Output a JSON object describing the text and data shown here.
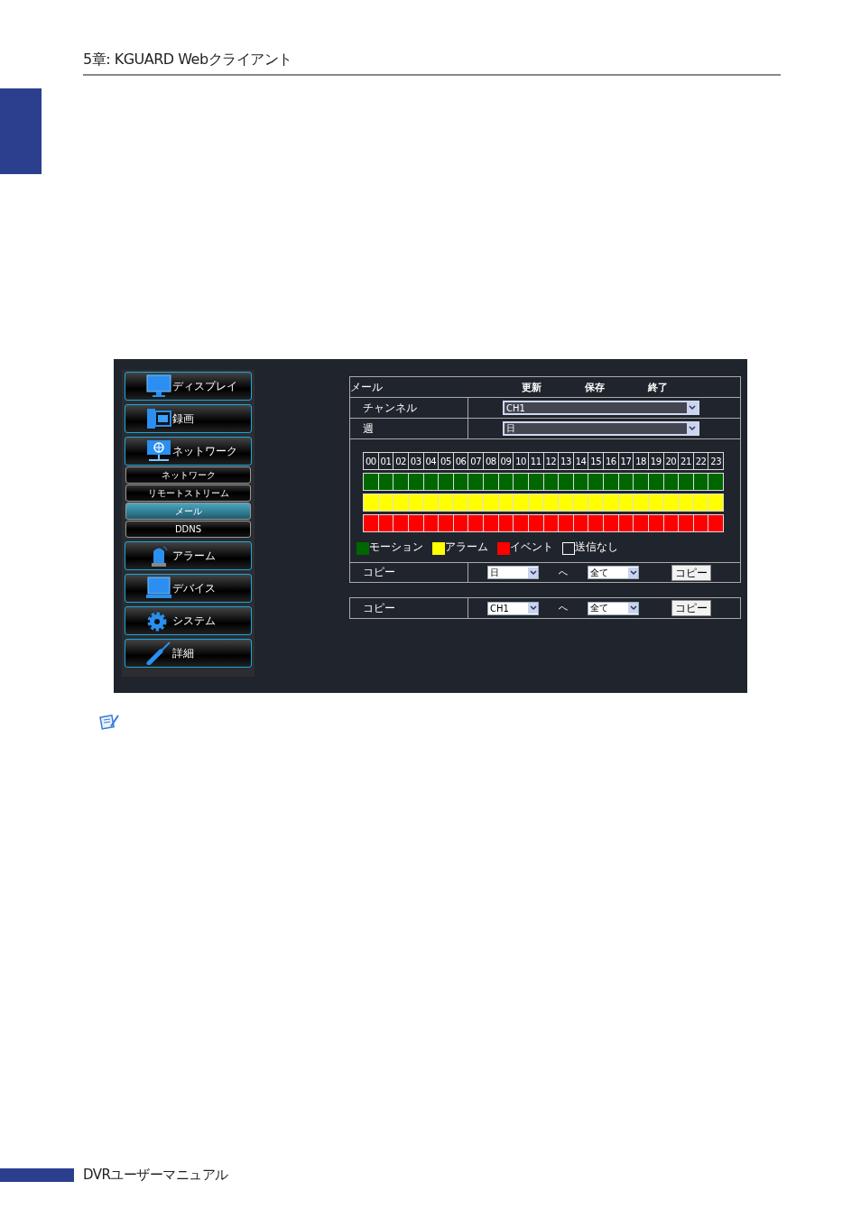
{
  "page_header": {
    "title": "5章: KGUARD Webクライアント"
  },
  "sidebar": {
    "items": [
      {
        "label": "ディスプレイ",
        "kind": "monitor"
      },
      {
        "label": "録画",
        "kind": "film"
      },
      {
        "label": "ネットワーク",
        "kind": "network",
        "children": [
          {
            "label": "ネットワーク",
            "selected": false
          },
          {
            "label": "リモートストリーム",
            "selected": false
          },
          {
            "label": "メール",
            "selected": true
          },
          {
            "label": "DDNS",
            "selected": false
          }
        ]
      },
      {
        "label": "アラーム",
        "kind": "alarm"
      },
      {
        "label": "デバイス",
        "kind": "laptop"
      },
      {
        "label": "システム",
        "kind": "gear"
      },
      {
        "label": "詳細",
        "kind": "tool"
      }
    ]
  },
  "panel": {
    "title": "メール",
    "actions": [
      "更新",
      "保存",
      "終了"
    ],
    "fields": [
      {
        "label": "チャンネル",
        "value": "CH1"
      },
      {
        "label": "週",
        "value": "日"
      }
    ],
    "hours": [
      "00",
      "01",
      "02",
      "03",
      "04",
      "05",
      "06",
      "07",
      "08",
      "09",
      "10",
      "11",
      "12",
      "13",
      "14",
      "15",
      "16",
      "17",
      "18",
      "19",
      "20",
      "21",
      "22",
      "23"
    ],
    "schedule_rows": [
      {
        "color": "#006600"
      },
      {
        "color": "#ffff00"
      },
      {
        "color": "#ff0000"
      }
    ],
    "legend": [
      {
        "label": "モーション",
        "kind": "swatch",
        "color": "#006600"
      },
      {
        "label": "アラーム",
        "kind": "swatch",
        "color": "#ffff00"
      },
      {
        "label": "イベント",
        "kind": "swatch",
        "color": "#ff0000"
      },
      {
        "label": "送信なし",
        "kind": "empty"
      }
    ],
    "copy_rows": [
      {
        "label": "コピー",
        "from": "日",
        "arrow": "へ",
        "to": "全て",
        "button": "コピー"
      },
      {
        "label": "コピー",
        "from": "CH1",
        "arrow": "へ",
        "to": "全て",
        "button": "コピー"
      }
    ]
  },
  "footer": {
    "title": "DVRユーザーマニュアル"
  }
}
